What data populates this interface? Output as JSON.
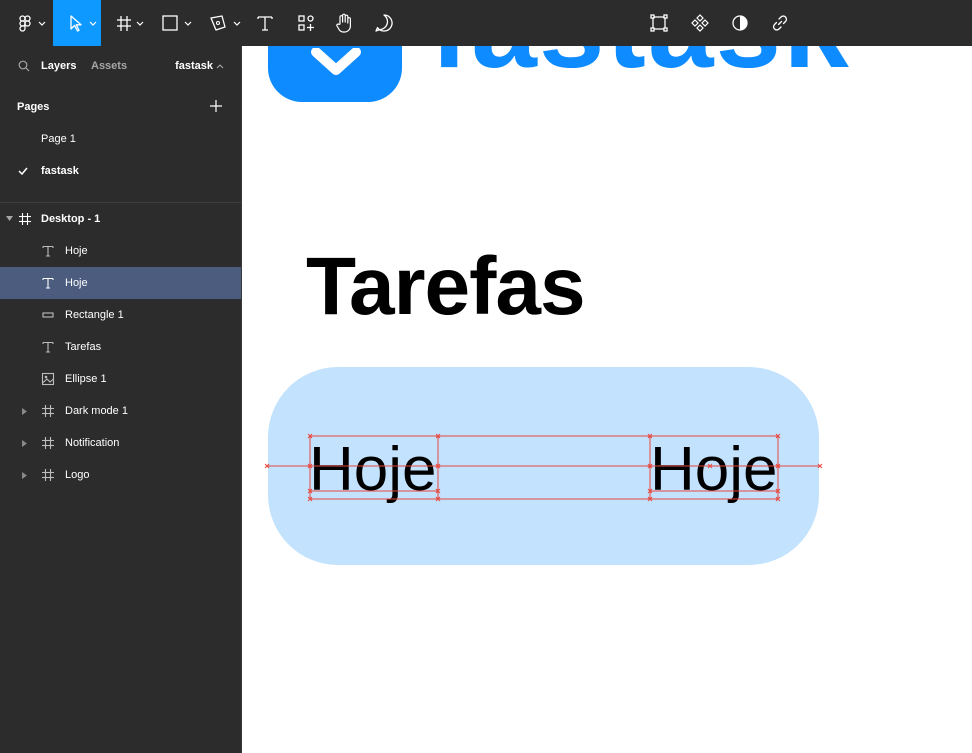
{
  "toolbar": {
    "tools": [
      "main-menu",
      "move",
      "frame",
      "shape",
      "pen",
      "text",
      "resources",
      "hand",
      "comment"
    ],
    "active_tool": "move",
    "right_tools": [
      "component",
      "instance",
      "contrast",
      "link"
    ]
  },
  "sidebar": {
    "tabs": {
      "layers": "Layers",
      "assets": "Assets"
    },
    "file_name": "fastask",
    "pages_title": "Pages",
    "pages": [
      {
        "label": "Page 1",
        "checked": false
      },
      {
        "label": "fastask",
        "checked": true
      }
    ],
    "layers": [
      {
        "label": "Desktop - 1",
        "icon": "frame-icon",
        "level": 0,
        "expanded": true,
        "bold": true
      },
      {
        "label": "Hoje",
        "icon": "text-icon",
        "level": 1
      },
      {
        "label": "Hoje",
        "icon": "text-icon",
        "level": 1,
        "selected": true
      },
      {
        "label": "Rectangle 1",
        "icon": "rectangle-icon",
        "level": 1
      },
      {
        "label": "Tarefas",
        "icon": "text-icon",
        "level": 1
      },
      {
        "label": "Ellipse 1",
        "icon": "image-icon",
        "level": 1
      },
      {
        "label": "Dark mode 1",
        "icon": "frame-icon",
        "level": 1,
        "collapsed": true
      },
      {
        "label": "Notification",
        "icon": "frame-icon",
        "level": 1,
        "collapsed": true
      },
      {
        "label": "Logo",
        "icon": "frame-icon",
        "level": 1,
        "collapsed": true
      }
    ]
  },
  "canvas": {
    "logo_text": "fastask",
    "heading": "Tarefas",
    "pill_texts": [
      "Hoje",
      "Hoje"
    ],
    "colors": {
      "brand": "#0d8bff",
      "pill": "#c2e2fd",
      "selection": "#4b5c7f",
      "active_tool": "#0d99ff",
      "guide": "#e8483e"
    }
  }
}
